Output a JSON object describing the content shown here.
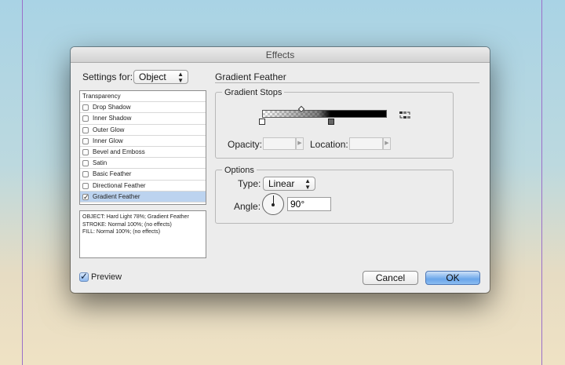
{
  "dialog": {
    "title": "Effects"
  },
  "settings_for": {
    "label": "Settings for:",
    "value": "Object"
  },
  "effects_list": {
    "header": "Transparency",
    "items": [
      {
        "label": "Drop Shadow",
        "checked": false
      },
      {
        "label": "Inner Shadow",
        "checked": false
      },
      {
        "label": "Outer Glow",
        "checked": false
      },
      {
        "label": "Inner Glow",
        "checked": false
      },
      {
        "label": "Bevel and Emboss",
        "checked": false
      },
      {
        "label": "Satin",
        "checked": false
      },
      {
        "label": "Basic Feather",
        "checked": false
      },
      {
        "label": "Directional Feather",
        "checked": false
      },
      {
        "label": "Gradient Feather",
        "checked": true,
        "selected": true
      }
    ],
    "check_glyph": "✓"
  },
  "summary": {
    "lines": [
      "OBJECT: Hard Light 78%; Gradient Feather",
      "STROKE: Normal 100%; (no effects)",
      "FILL: Normal 100%; (no effects)"
    ]
  },
  "preview": {
    "label": "Preview",
    "checked": true
  },
  "panel": {
    "title": "Gradient Feather"
  },
  "gradient_stops": {
    "title": "Gradient Stops",
    "opacity_label": "Opacity:",
    "location_label": "Location:",
    "opacity_value": "",
    "location_value": "",
    "reverse_icon": "reverse-gradient-icon"
  },
  "options": {
    "title": "Options",
    "type_label": "Type:",
    "type_value": "Linear",
    "angle_label": "Angle:",
    "angle_value": "90°"
  },
  "buttons": {
    "cancel": "Cancel",
    "ok": "OK"
  },
  "colors": {
    "default_button": "#6aa6ea",
    "selected_row": "#bcd3ef",
    "guide": "#9b6fc9"
  }
}
